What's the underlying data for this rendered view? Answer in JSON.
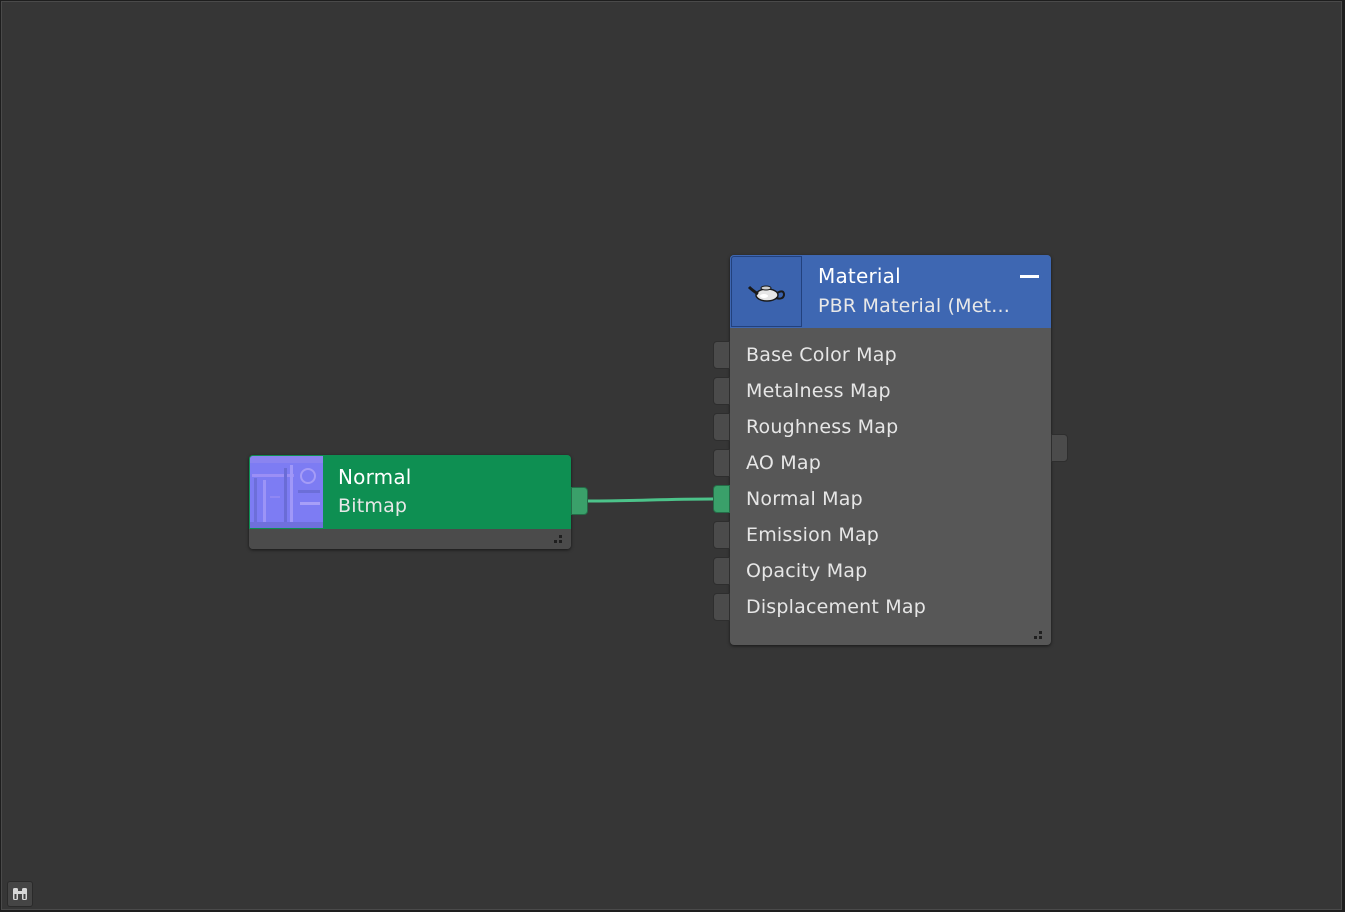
{
  "canvas": {
    "background": "#363636",
    "wire_color": "#4cc38a"
  },
  "bitmap_node": {
    "title": "Normal",
    "subtitle": "Bitmap",
    "header_color": "#0e8f52",
    "thumbnail_icon": "normal-map-preview"
  },
  "material_node": {
    "title": "Material",
    "subtitle": "PBR Material (Met...",
    "header_color": "#3e67b2",
    "icon": "teapot-icon",
    "collapse_icon": "minus-icon",
    "inputs": [
      "Base Color Map",
      "Metalness Map",
      "Roughness Map",
      "AO Map",
      "Normal Map",
      "Emission Map",
      "Opacity Map",
      "Displacement Map"
    ]
  },
  "toolbar": {
    "overview_icon": "binoculars-icon"
  }
}
